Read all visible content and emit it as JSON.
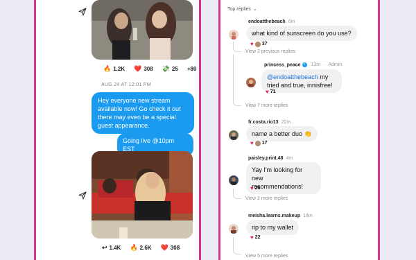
{
  "left": {
    "post1_reactions": [
      {
        "emoji": "🔥",
        "count": "1.2K"
      },
      {
        "emoji": "❤️",
        "count": "308"
      },
      {
        "emoji": "💸",
        "count": "25"
      },
      {
        "emoji": "",
        "count": "+80"
      }
    ],
    "timestamp": "AUG 24 AT 12:01 PM",
    "message1": "Hey everyone new stream available now! Go check it out there may even be a special guest appearance.",
    "message2": "Going live @10pm EST",
    "post2_reactions": [
      {
        "emoji": "↩",
        "count": "1.4K"
      },
      {
        "emoji": "🔥",
        "count": "2.6K"
      },
      {
        "emoji": "❤️",
        "count": "308"
      }
    ]
  },
  "right": {
    "sort_label": "Top replies",
    "comments": [
      {
        "user": "endoatthebeach",
        "time": "6m",
        "text": "what kind of sunscreen do you use?",
        "likes": "37"
      },
      {
        "user": "fr.costa.rio13",
        "time": "22m",
        "text": "name a better duo",
        "emoji": "👏",
        "likes": "17"
      },
      {
        "user": "paisley.print.48",
        "time": "4m",
        "text": "Yay I'm looking for new recommendations!",
        "likes": "26"
      },
      {
        "user": "meisha.learns.makeup",
        "time": "18m",
        "text": "rip to my wallet",
        "likes": "22"
      }
    ],
    "reply": {
      "user": "princess_peace",
      "time": "13m",
      "role": "Admin",
      "mention": "@endoatthebeach",
      "text": " my tried and true, innisfree!",
      "likes": "71"
    },
    "view_previous": "View 2 previous replies",
    "view_more_7": "View 7 more replies",
    "view_more_2": "View 2 more replies",
    "bottom_partial": "View 5 more replies"
  }
}
